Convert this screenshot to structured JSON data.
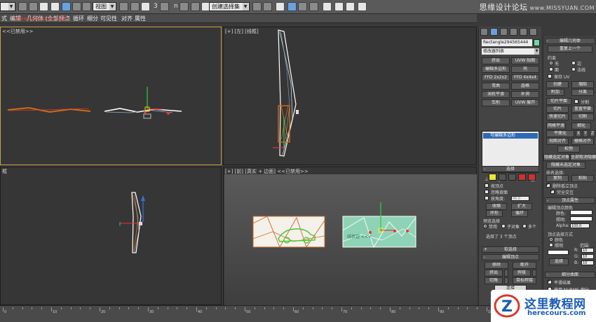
{
  "toolbar": {
    "combo_main": "",
    "combo_view": "视图",
    "combo_selection_set": "创建选择集",
    "snap_label": "3",
    "angle_label": "n",
    "watermark": "思缘设计论坛",
    "watermark_site": "www.MISSYUAN.COM"
  },
  "menubar": {
    "red_title": "www.sxlw.com 设计...",
    "items": [
      "式",
      "编辑",
      "几何体 (全部)",
      "顶点",
      "循环",
      "细分",
      "可见性",
      "对齐",
      "属性"
    ]
  },
  "viewports": {
    "top_left": {
      "label": "<<已禁用>>"
    },
    "top_right": {
      "label": "[+] [左] [线框]"
    },
    "bottom_left": {
      "label": "框"
    },
    "bottom_right": {
      "label": "[+] [前] [真实 + 边面] <<已禁用>>",
      "overlay_text": "线状边 <<<"
    }
  },
  "command_panel": {
    "object_name": "Rectangle294565444",
    "object_color": "#6fd7a6",
    "modifier_list": "修改器列表",
    "buttons": [
      [
        "挤出",
        "UVW 贴图"
      ],
      [
        "编辑多边形",
        "壳"
      ],
      [
        "FFD 2x2x2",
        "FFD 4x4x4"
      ],
      [
        "弯曲",
        "晶格"
      ],
      [
        "涡轮平滑",
        "补洞"
      ],
      [
        "车削",
        "UVW 展开"
      ]
    ],
    "stack_item": "可编辑多边形",
    "selection": {
      "header": "选择",
      "by_vertex": "按顶点",
      "ignore_backfacing": "忽略背面",
      "by_angle": "按角度:",
      "angle_value": "45.0",
      "shrink": "收缩",
      "grow": "扩大",
      "ring": "环形",
      "loop": "循环",
      "preview_selection": "预览选择",
      "off": "禁用",
      "subobject": "子对象",
      "multi": "多个",
      "status": "选择了 3 个顶点"
    },
    "soft_selection": {
      "header": "软选择"
    },
    "edit_vertices": {
      "header": "编辑顶点",
      "remove": "移除",
      "break": "断开",
      "extrude": "挤出",
      "weld": "焊接",
      "chamfer": "切角",
      "target_weld": "目标焊接",
      "connect": "连接"
    }
  },
  "right_panel": {
    "edit_geometry": "编辑几何体",
    "repeat_last": "重复上一个",
    "constraints": "约束",
    "none": "无",
    "edge": "边",
    "face": "面",
    "normal": "法线",
    "preserve_uvs": "保持 UV",
    "create": "创建",
    "collapse": "塌陷",
    "attach": "附加",
    "detach": "分离",
    "slice_plane": "切片平面",
    "split": "分割",
    "slice": "切片",
    "reset_plane": "重置平面",
    "quickslice": "快速切片",
    "cut": "切割",
    "meshsmooth": "网格平滑",
    "tessellate": "细化",
    "make_planar": "平面化",
    "x": "X",
    "y": "Y",
    "z": "Z",
    "view_align": "视图对齐",
    "grid_align": "栅格对齐",
    "relax": "松弛",
    "hide_selected": "隐藏选定对象",
    "unhide_all": "全部取消隐藏",
    "hide_unselected": "隐藏未选定对象",
    "named_selections": "命名选择:",
    "copy": "复制",
    "paste": "粘贴",
    "delete_isolated": "删除孤立顶点",
    "full_interactivity": "完全交互",
    "vertex_props": "顶点属性",
    "edit_vertex_colors": "编辑顶点颜色",
    "color": "颜色:",
    "illumination": "照明:",
    "alpha": "Alpha:",
    "alpha_value": "100.0",
    "select_vertices_by": "顶点选择方式",
    "by_color": "颜色",
    "by_illum": "照明",
    "range": "范围:",
    "r": "R:",
    "g": "G:",
    "b": "B:",
    "range_value": "10",
    "select_btn": "选择",
    "subdivision_surface": "细分曲面",
    "smooth_result": "平滑结果",
    "use_nurms": "使用 NURMS 细分"
  },
  "timeline": {
    "ticks": [
      "0",
      "10",
      "20",
      "30",
      "40",
      "50",
      "60",
      "70",
      "80",
      "90",
      "100"
    ]
  },
  "logo": {
    "name": "这里教程网",
    "url": "herecours.com"
  }
}
